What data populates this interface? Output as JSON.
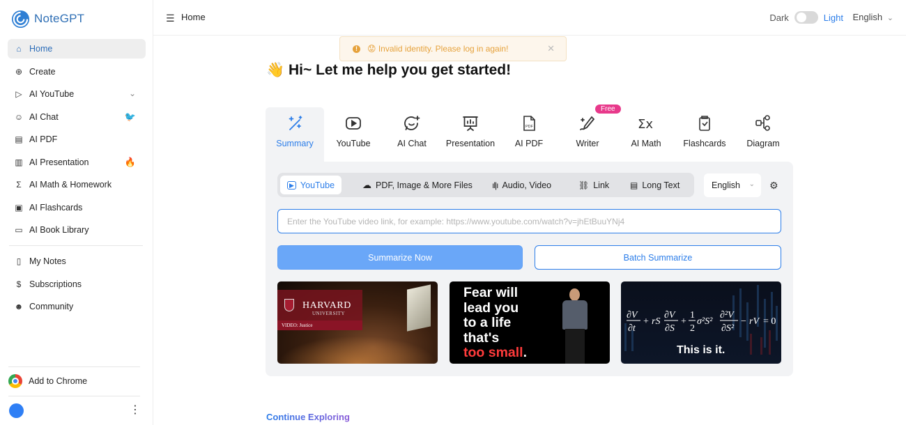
{
  "app": {
    "name": "NoteGPT"
  },
  "sidebar": {
    "items": [
      {
        "label": "Home",
        "icon": "home-icon"
      },
      {
        "label": "Create",
        "icon": "plus-circle-icon"
      },
      {
        "label": "AI YouTube",
        "icon": "youtube-icon"
      },
      {
        "label": "AI Chat",
        "icon": "chat-icon"
      },
      {
        "label": "AI PDF",
        "icon": "pdf-icon"
      },
      {
        "label": "AI Presentation",
        "icon": "presentation-icon"
      },
      {
        "label": "AI Math & Homework",
        "icon": "sigma-icon"
      },
      {
        "label": "AI Flashcards",
        "icon": "flashcards-icon"
      },
      {
        "label": "AI Book Library",
        "icon": "book-icon"
      }
    ],
    "items2": [
      {
        "label": "My Notes",
        "icon": "notes-icon"
      },
      {
        "label": "Subscriptions",
        "icon": "dollar-icon"
      },
      {
        "label": "Community",
        "icon": "community-icon"
      }
    ],
    "add_chrome": "Add to Chrome"
  },
  "topbar": {
    "title": "Home",
    "dark_label": "Dark",
    "light_label": "Light",
    "language": "English"
  },
  "toast": {
    "message": "😟 Invalid identity. Please log in again!"
  },
  "heading": "👋 Hi~ Let me help you get started!",
  "tools": [
    {
      "label": "Summary",
      "icon": "sparkle-pen-icon"
    },
    {
      "label": "YouTube",
      "icon": "play-icon"
    },
    {
      "label": "AI Chat",
      "icon": "chat-sparkle-icon"
    },
    {
      "label": "Presentation",
      "icon": "presentation-board-icon"
    },
    {
      "label": "AI PDF",
      "icon": "pdf-file-icon"
    },
    {
      "label": "Writer",
      "icon": "writer-pen-icon"
    },
    {
      "label": "AI Math",
      "icon": "sigma-x-icon"
    },
    {
      "label": "Flashcards",
      "icon": "flashcard-icon"
    },
    {
      "label": "Diagram",
      "icon": "diagram-icon"
    }
  ],
  "free_badge": "Free",
  "subtabs": [
    {
      "label": "YouTube",
      "icon": "▶"
    },
    {
      "label": "PDF, Image & More Files",
      "icon": "☁"
    },
    {
      "label": "Audio, Video",
      "icon": "〰"
    },
    {
      "label": "Link",
      "icon": "🔗"
    },
    {
      "label": "Long Text",
      "icon": "🗎"
    }
  ],
  "panel": {
    "language": "English",
    "placeholder": "Enter the YouTube video link, for example: https://www.youtube.com/watch?v=jhEtBuuYNj4",
    "summarize_now": "Summarize Now",
    "batch_summarize": "Batch Summarize"
  },
  "thumbnails": {
    "harvard": {
      "name": "HARVARD",
      "university": "UNIVERSITY",
      "strip": "VIDEO: Justice"
    },
    "fear": {
      "lines": [
        "Fear will",
        "lead you",
        "to a life",
        "that's"
      ],
      "last_red": "too small",
      "last_dot": "."
    },
    "equation": {
      "formula": "∂V/∂t + rS ∂V/∂S + ½σ²S² ∂²V/∂S² − rV = 0",
      "caption": "This is it."
    }
  },
  "continue_exploring": "Continue Exploring"
}
